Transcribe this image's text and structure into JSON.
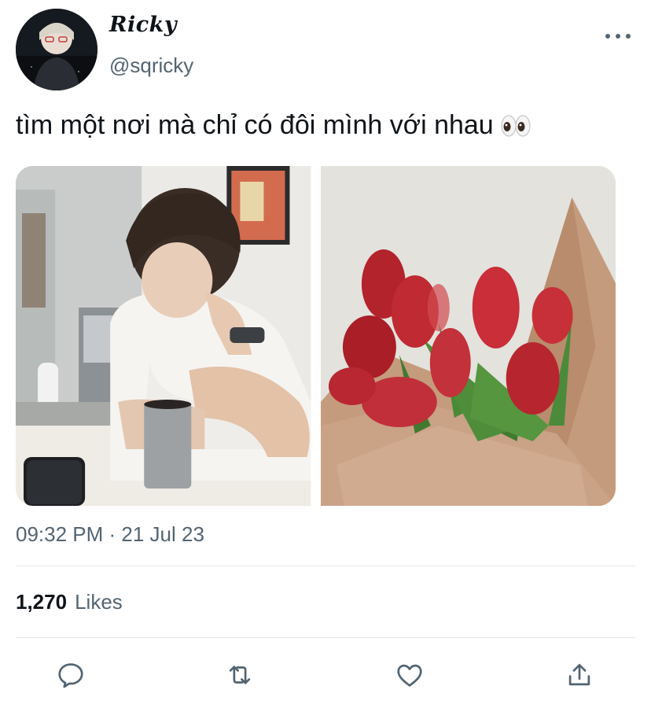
{
  "tweet": {
    "display_name": "Ricky",
    "handle": "@sqricky",
    "text": "tìm một nơi mà chỉ có đôi mình với nhau",
    "emoji": "eyes-emoji",
    "timestamp": "09:32 PM · 21 Jul 23",
    "likes_count": "1,270",
    "likes_label": "Likes"
  },
  "media": [
    {
      "name": "photo-person-at-cafe-table",
      "description_icon": "photo"
    },
    {
      "name": "photo-red-tulip-bouquet",
      "description_icon": "photo"
    }
  ],
  "actions": [
    {
      "name": "reply-icon"
    },
    {
      "name": "retweet-icon"
    },
    {
      "name": "like-icon"
    },
    {
      "name": "share-icon"
    }
  ],
  "colors": {
    "text_primary": "#0f1419",
    "text_secondary": "#536471",
    "divider": "#e1e6ea",
    "icon": "#536471"
  }
}
